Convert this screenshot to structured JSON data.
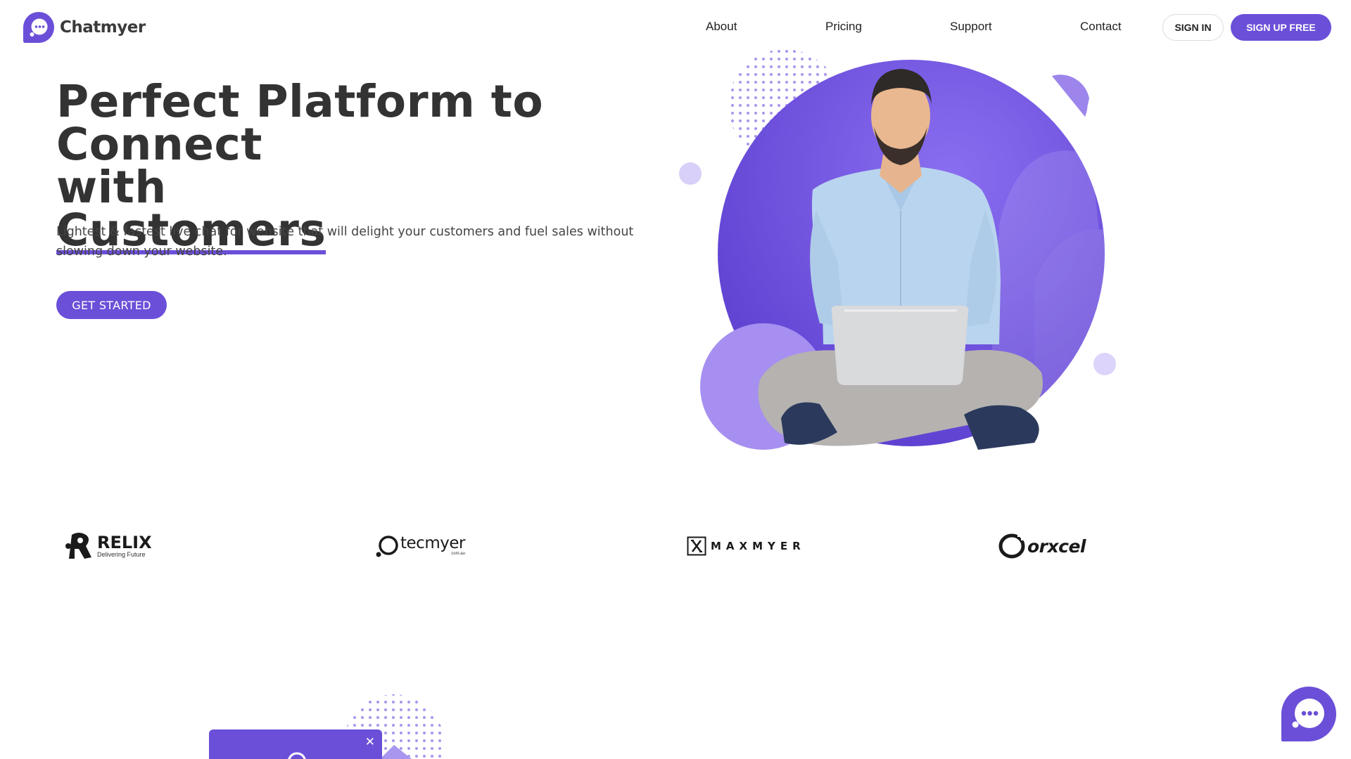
{
  "brand": {
    "name": "Chatmyer",
    "accent": "#6b4fd8"
  },
  "nav": {
    "items": [
      {
        "label": "About"
      },
      {
        "label": "Pricing"
      },
      {
        "label": "Support"
      },
      {
        "label": "Contact"
      }
    ],
    "sign_in": "SIGN IN",
    "sign_up": "SIGN UP FREE"
  },
  "hero": {
    "title_line1": "Perfect Platform to Connect",
    "title_line2": "with",
    "title_line3": "Customers",
    "subtitle": "Lightest & fastest live chat for website that will delight your customers and fuel sales without slowing down your website.",
    "cta": "GET STARTED"
  },
  "partners": [
    {
      "name": "RELIX",
      "tagline": "Delivering Future",
      "icon": "relix-logo-icon"
    },
    {
      "name": "tecmyer",
      "tagline": "com.au",
      "icon": "tecmyer-logo-icon"
    },
    {
      "name": "MAXMYER",
      "icon": "maxmyer-logo-icon"
    },
    {
      "name": "orxcel",
      "icon": "orxcel-logo-icon"
    }
  ],
  "widget": {
    "close_glyph": "✕"
  },
  "icons": {
    "logo": "chat-bubble-icon",
    "fab": "chat-bubble-icon"
  }
}
